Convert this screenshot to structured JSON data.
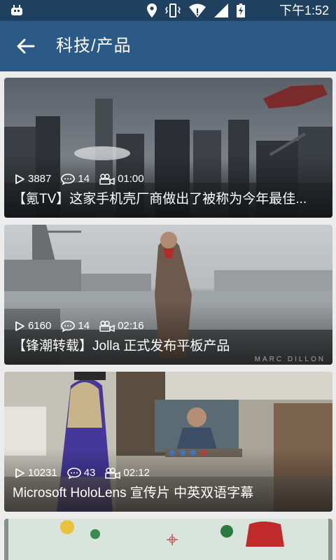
{
  "status_bar": {
    "time": "下午1:52",
    "icons": [
      "android-bug-icon",
      "location-icon",
      "vibrate-icon",
      "wifi-icon",
      "signal-icon",
      "battery-charging-icon"
    ]
  },
  "toolbar": {
    "title": "科技/产品",
    "back_icon": "arrow-back-icon"
  },
  "colors": {
    "status_bar_bg": "#20405f",
    "toolbar_bg": "#2b5a87",
    "page_bg": "#ececec"
  },
  "videos": [
    {
      "plays": "3887",
      "comments": "14",
      "duration": "01:00",
      "title": "【氪TV】这家手机壳厂商做出了被称为今年最佳..."
    },
    {
      "plays": "6160",
      "comments": "14",
      "duration": "02:16",
      "title": "【锋潮转载】Jolla 正式发布平板产品",
      "watermark": "MARC DILLON"
    },
    {
      "plays": "10231",
      "comments": "43",
      "duration": "02:12",
      "title": "Microsoft HoloLens 宣传片 中英双语字幕"
    }
  ]
}
